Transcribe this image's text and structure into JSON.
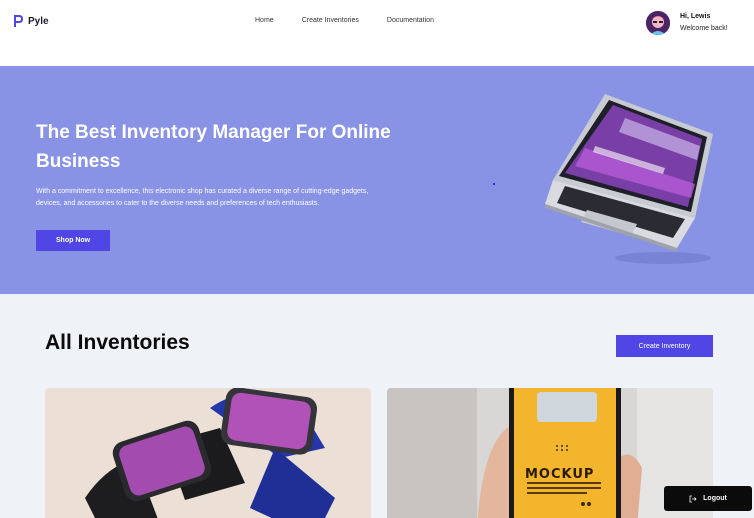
{
  "brand": {
    "name": "Pyle",
    "accent": "#4f46e5"
  },
  "nav": {
    "items": [
      {
        "label": "Home"
      },
      {
        "label": "Create Inventories"
      },
      {
        "label": "Documentation"
      }
    ]
  },
  "user": {
    "greeting": "Hi, Lewis",
    "subtitle": "Welcome back!"
  },
  "hero": {
    "title": "The Best Inventory Manager For Online Business",
    "description": "With a commitment to excellence, this electronic shop has curated a diverse range of cutting-edge gadgets, devices, and accessories to cater to the diverse needs and preferences of tech enthusiasts.",
    "cta_label": "Shop Now",
    "background": "#8893e5"
  },
  "inventories": {
    "title": "All Inventories",
    "create_label": "Create Inventory",
    "cards": [
      {
        "image": "smartwatch-image"
      },
      {
        "image": "phone-mockup-image",
        "mockup_text": "MOCKUP"
      }
    ]
  },
  "logout": {
    "label": "Logout"
  }
}
